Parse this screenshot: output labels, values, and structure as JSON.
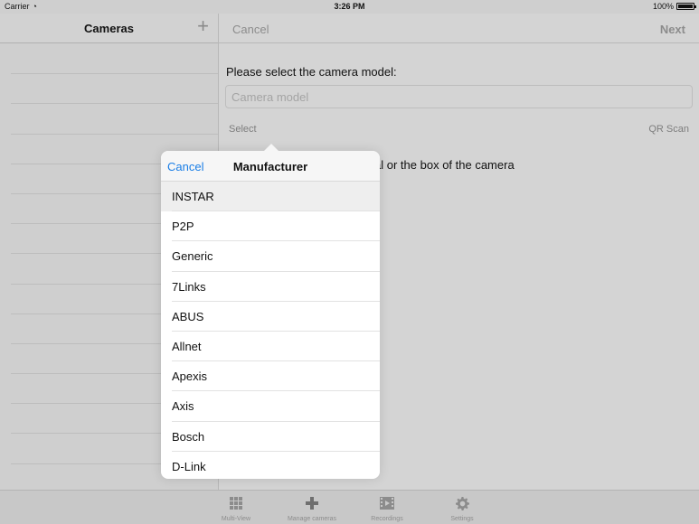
{
  "status_bar": {
    "carrier": "Carrier",
    "time": "3:26 PM",
    "battery": "100%"
  },
  "master": {
    "title": "Cameras",
    "add_icon": "plus-icon",
    "add_label": "+"
  },
  "detail": {
    "cancel_label": "Cancel",
    "next_label": "Next",
    "prompt": "Please select the camera model:",
    "model_placeholder": "Camera model",
    "select_label": "Select",
    "qr_label": "QR Scan",
    "hint": "Please check the user manual or the box of the camera"
  },
  "popover": {
    "cancel_label": "Cancel",
    "title": "Manufacturer",
    "items": [
      {
        "label": "INSTAR",
        "selected": true
      },
      {
        "label": "P2P",
        "selected": false
      },
      {
        "label": "Generic",
        "selected": false
      },
      {
        "label": "7Links",
        "selected": false
      },
      {
        "label": "ABUS",
        "selected": false
      },
      {
        "label": "Allnet",
        "selected": false
      },
      {
        "label": "Apexis",
        "selected": false
      },
      {
        "label": "Axis",
        "selected": false
      },
      {
        "label": "Bosch",
        "selected": false
      },
      {
        "label": "D-Link",
        "selected": false
      }
    ]
  },
  "tabbar": {
    "tabs": [
      {
        "label": "Multi-View",
        "icon": "grid-icon"
      },
      {
        "label": "Manage cameras",
        "icon": "plus-icon"
      },
      {
        "label": "Recordings",
        "icon": "film-icon"
      },
      {
        "label": "Settings",
        "icon": "gear-icon"
      }
    ]
  },
  "colors": {
    "accent": "#1a7ee6",
    "disabled_text": "#8c8c8c"
  }
}
